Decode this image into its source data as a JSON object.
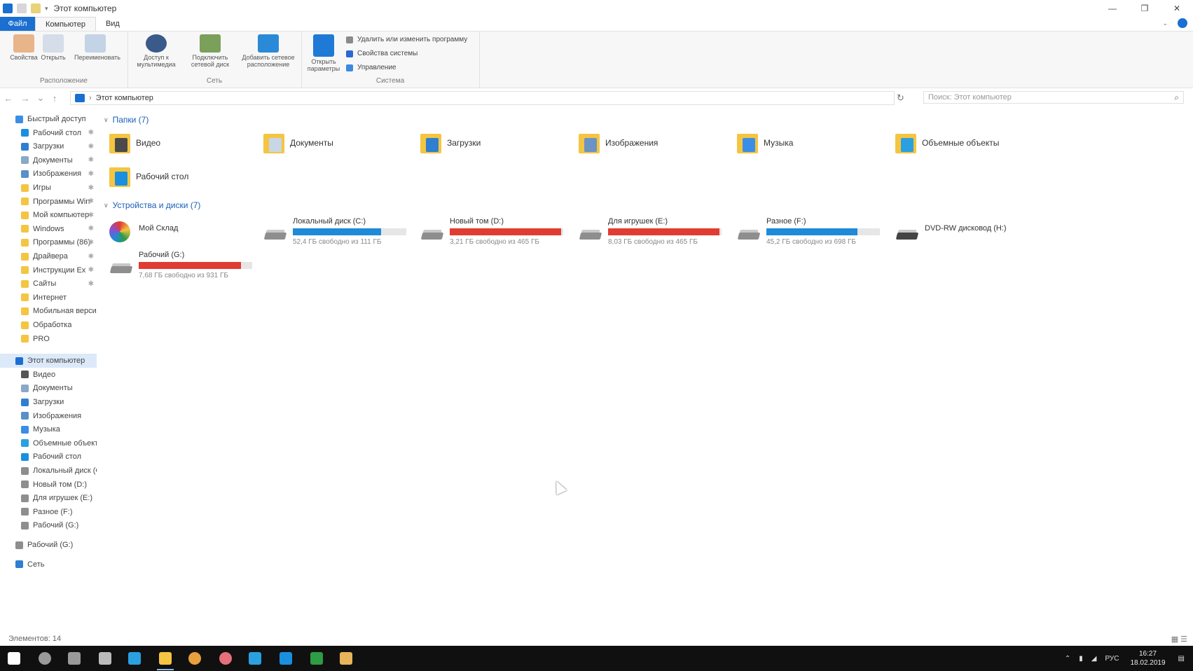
{
  "window": {
    "title": "Этот компьютер",
    "minimize_icon": "minimize-icon",
    "maximize_icon": "maximize-icon",
    "close_icon": "close-icon"
  },
  "ribbon_tabs": [
    {
      "label": "Файл"
    },
    {
      "label": "Компьютер"
    },
    {
      "label": "Вид"
    }
  ],
  "ribbon": {
    "groups": [
      {
        "label": "Расположение"
      },
      {
        "label": "Сеть"
      },
      {
        "label": "Система"
      }
    ],
    "buttons": [
      {
        "label": "Свойства"
      },
      {
        "label": "Открыть"
      },
      {
        "label": "Переименовать"
      },
      {
        "label": "Доступ к мультимедиа"
      },
      {
        "label": "Подключить сетевой диск"
      },
      {
        "label": "Добавить сетевое расположение"
      },
      {
        "label": "Открыть параметры"
      }
    ],
    "small_buttons": [
      {
        "label": "Удалить или изменить программу"
      },
      {
        "label": "Свойства системы"
      },
      {
        "label": "Управление"
      }
    ]
  },
  "address": {
    "path": "Этот компьютер",
    "search_placeholder": "Поиск: Этот компьютер"
  },
  "sidebar": {
    "items": [
      {
        "label": "Быстрый доступ",
        "color": "#3b8ee6",
        "pinned": false,
        "indent": 0
      },
      {
        "label": "Рабочий стол",
        "color": "#1a8fe0",
        "pinned": true,
        "indent": 1
      },
      {
        "label": "Загрузки",
        "color": "#2f7fd0",
        "pinned": true,
        "indent": 1
      },
      {
        "label": "Документы",
        "color": "#8aa8c8",
        "pinned": true,
        "indent": 1
      },
      {
        "label": "Изображения",
        "color": "#5a8fc8",
        "pinned": true,
        "indent": 1
      },
      {
        "label": "Игры",
        "color": "#f4c542",
        "pinned": true,
        "indent": 1
      },
      {
        "label": "Программы Win",
        "color": "#f4c542",
        "pinned": true,
        "indent": 1
      },
      {
        "label": "Мой компьютер",
        "color": "#f4c542",
        "pinned": true,
        "indent": 1
      },
      {
        "label": "Windows",
        "color": "#f4c542",
        "pinned": true,
        "indent": 1
      },
      {
        "label": "Программы (86)",
        "color": "#f4c542",
        "pinned": true,
        "indent": 1
      },
      {
        "label": "Драйвера",
        "color": "#f4c542",
        "pinned": true,
        "indent": 1
      },
      {
        "label": "Инструкции Ex",
        "color": "#f4c542",
        "pinned": true,
        "indent": 1
      },
      {
        "label": "Сайты",
        "color": "#f4c542",
        "pinned": true,
        "indent": 1
      },
      {
        "label": "Интернет",
        "color": "#f4c542",
        "pinned": false,
        "indent": 1
      },
      {
        "label": "Мобильная версия",
        "color": "#f4c542",
        "pinned": false,
        "indent": 1
      },
      {
        "label": "Обработка",
        "color": "#f4c542",
        "pinned": false,
        "indent": 1
      },
      {
        "label": "PRO",
        "color": "#f4c542",
        "pinned": false,
        "indent": 1
      },
      {
        "label": "Этот компьютер",
        "color": "#1a6fd1",
        "pinned": false,
        "indent": 0,
        "selected": true
      },
      {
        "label": "Видео",
        "color": "#555555",
        "pinned": false,
        "indent": 1
      },
      {
        "label": "Документы",
        "color": "#8aa8c8",
        "pinned": false,
        "indent": 1
      },
      {
        "label": "Загрузки",
        "color": "#2f7fd0",
        "pinned": false,
        "indent": 1
      },
      {
        "label": "Изображения",
        "color": "#5a8fc8",
        "pinned": false,
        "indent": 1
      },
      {
        "label": "Музыка",
        "color": "#3b8ee6",
        "pinned": false,
        "indent": 1
      },
      {
        "label": "Объемные объекты",
        "color": "#2aa0e0",
        "pinned": false,
        "indent": 1
      },
      {
        "label": "Рабочий стол",
        "color": "#1a8fe0",
        "pinned": false,
        "indent": 1
      },
      {
        "label": "Локальный диск (C:)",
        "color": "#8e8e8e",
        "pinned": false,
        "indent": 1
      },
      {
        "label": "Новый том (D:)",
        "color": "#8e8e8e",
        "pinned": false,
        "indent": 1
      },
      {
        "label": "Для игрушек (E:)",
        "color": "#8e8e8e",
        "pinned": false,
        "indent": 1
      },
      {
        "label": "Разное (F:)",
        "color": "#8e8e8e",
        "pinned": false,
        "indent": 1
      },
      {
        "label": "Рабочий (G:)",
        "color": "#8e8e8e",
        "pinned": false,
        "indent": 1
      },
      {
        "label": "Рабочий (G:)",
        "color": "#8e8e8e",
        "pinned": false,
        "indent": 0
      },
      {
        "label": "Сеть",
        "color": "#2f7fd0",
        "pinned": false,
        "indent": 0
      }
    ]
  },
  "sections": {
    "folders_header": "Папки (7)",
    "drives_header": "Устройства и диски (7)"
  },
  "folders": [
    {
      "name": "Видео",
      "accent": "#4a4a4a"
    },
    {
      "name": "Документы",
      "accent": "#c9d6e6"
    },
    {
      "name": "Загрузки",
      "accent": "#2f7fd0"
    },
    {
      "name": "Изображения",
      "accent": "#6b93c4"
    },
    {
      "name": "Музыка",
      "accent": "#3b8ee6"
    },
    {
      "name": "Объемные объекты",
      "accent": "#2aa0e0"
    },
    {
      "name": "Рабочий стол",
      "accent": "#1a8fe0"
    }
  ],
  "drives": [
    {
      "name": "Мой Склад",
      "media": true
    },
    {
      "name": "Локальный диск (C:)",
      "free": "52,4 ГБ свободно из 111 ГБ",
      "usage": 0.78,
      "color": "#1f8ad8"
    },
    {
      "name": "Новый том (D:)",
      "free": "3,21 ГБ свободно из 465 ГБ",
      "usage": 0.98,
      "color": "#e03c31"
    },
    {
      "name": "Для игрушек (E:)",
      "free": "8,03 ГБ свободно из 465 ГБ",
      "usage": 0.98,
      "color": "#e03c31"
    },
    {
      "name": "Разное (F:)",
      "free": "45,2 ГБ свободно из 698 ГБ",
      "usage": 0.8,
      "color": "#1f8ad8"
    },
    {
      "name": "DVD-RW дисковод (H:)",
      "media": true,
      "optical": true
    },
    {
      "name": "Рабочий (G:)",
      "free": "7,68 ГБ свободно из 931 ГБ",
      "usage": 0.9,
      "color": "#e03c31"
    }
  ],
  "status": {
    "count": "Элементов: 14",
    "view_icons": "▦ ☰"
  },
  "taskbar": {
    "items": [
      {
        "name": "start",
        "color": "#ffffff"
      },
      {
        "name": "search",
        "color": "#9a9a9a"
      },
      {
        "name": "taskview",
        "color": "#9a9a9a"
      },
      {
        "name": "store",
        "color": "#bbbbbb"
      },
      {
        "name": "edge",
        "color": "#2aa0e0"
      },
      {
        "name": "explorer",
        "color": "#f4c542"
      },
      {
        "name": "chrome",
        "color": "#e8a03c"
      },
      {
        "name": "photos",
        "color": "#e6707a"
      },
      {
        "name": "skype",
        "color": "#2aa0e0"
      },
      {
        "name": "mail",
        "color": "#1a8fe0"
      },
      {
        "name": "excel",
        "color": "#2e9b45"
      },
      {
        "name": "app",
        "color": "#e8b45a"
      }
    ],
    "tray": {
      "time": "16:27",
      "date": "18.02.2019",
      "lang": "РУС"
    }
  }
}
